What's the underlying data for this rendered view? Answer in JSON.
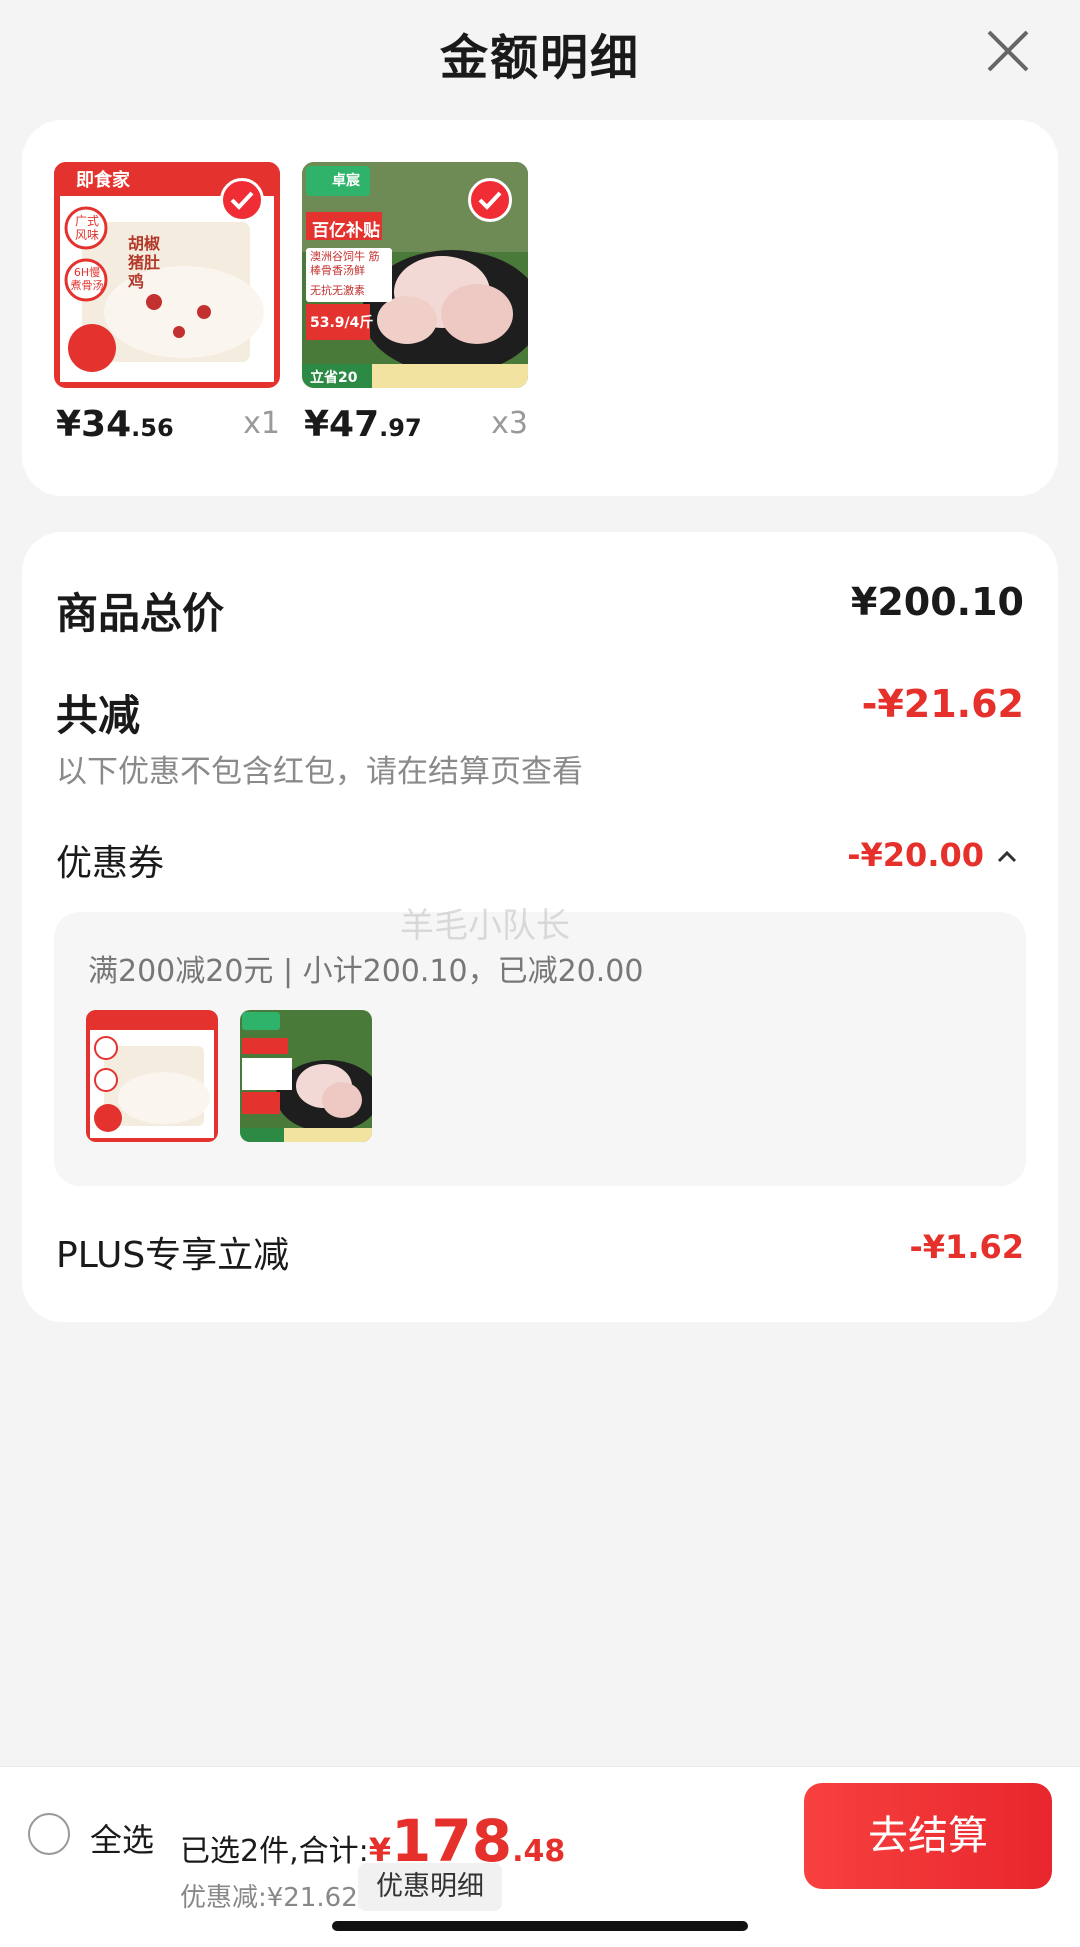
{
  "header": {
    "title": "金额明细"
  },
  "products": [
    {
      "price_int": "¥34",
      "price_dec": ".56",
      "qty": "x1",
      "brand": "即食家",
      "tag1": "广式风味",
      "tag2": "6H慢煮骨汤",
      "name": "胡椒猪肚鸡"
    },
    {
      "price_int": "¥47",
      "price_dec": ".97",
      "qty": "x3",
      "brand": "卓宸",
      "badge": "百亿补贴",
      "desc": "澳洲谷饲牛 筋棒骨香汤鲜",
      "noanti": "无抗无激素",
      "unit": "53.9/4斤",
      "save": "立省20"
    }
  ],
  "summary": {
    "total_label": "商品总价",
    "total_value": "¥200.10",
    "reduce_label": "共减",
    "reduce_value": "-¥21.62",
    "note": "以下优惠不包含红包，请在结算页查看",
    "coupon_label": "优惠券",
    "coupon_value": "-¥20.00",
    "coupon_detail": "满200减20元 | 小计200.10，已减20.00",
    "plus_label": "PLUS专享立减",
    "plus_value": "-¥1.62",
    "watermark": "羊毛小队长"
  },
  "footer": {
    "select_all": "全选",
    "selected_text": "已选2件,合计:",
    "yen": "¥",
    "total_int": "178",
    "total_dec": ".48",
    "discount_text": "优惠减:¥21.62",
    "detail_chip": "优惠明细",
    "checkout": "去结算"
  },
  "colors": {
    "accent": "#e5302b",
    "button": "#f02d35"
  }
}
